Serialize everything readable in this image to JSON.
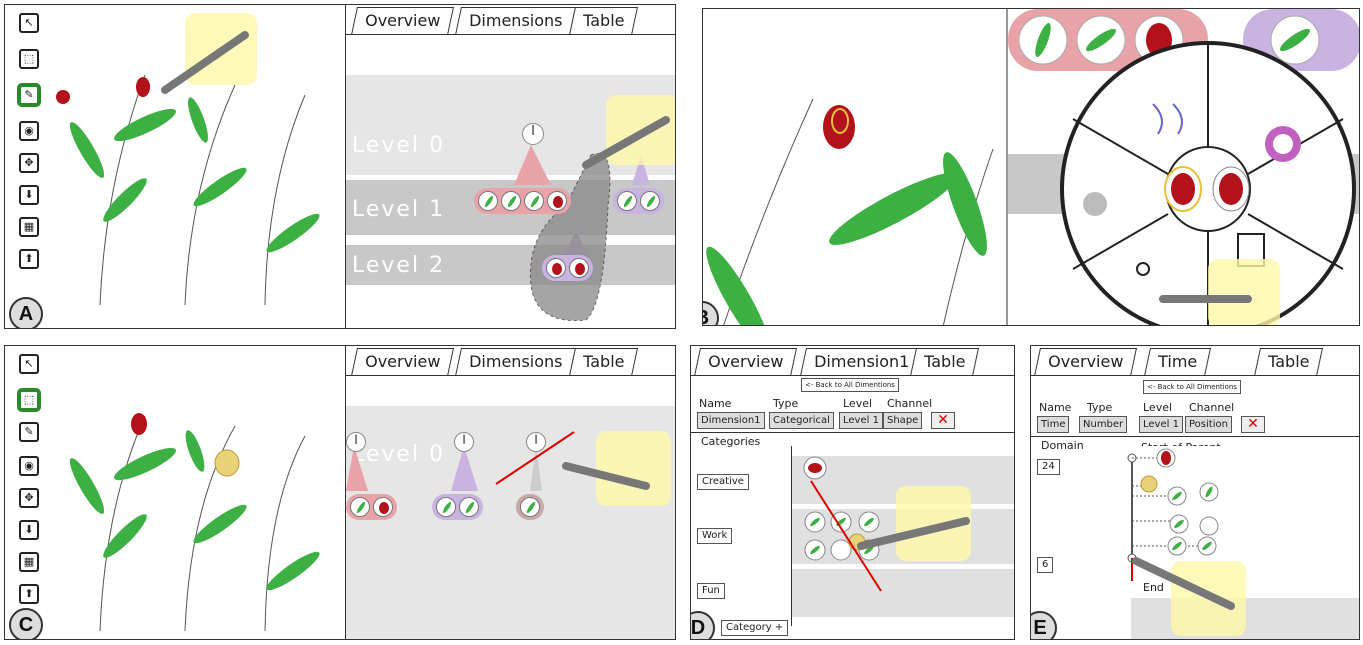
{
  "badges": {
    "a": "A",
    "b": "B",
    "c": "C",
    "d": "D",
    "e": "E"
  },
  "tabs": {
    "overview": "Overview",
    "dimensions": "Dimensions",
    "table": "Table",
    "dimension1": "Dimension1",
    "time": "Time"
  },
  "levels": {
    "l0": "Level 0",
    "l1": "Level 1",
    "l2": "Level 2"
  },
  "level_marker": "l",
  "panel_d": {
    "back_link": "<- Back to All Dimentions",
    "headers": {
      "name": "Name",
      "type": "Type",
      "level": "Level",
      "channel": "Channel"
    },
    "values": {
      "name": "Dimension1",
      "type": "Categorical",
      "level": "Level 1",
      "channel": "Shape"
    },
    "delete": "✕",
    "categories_label": "Categories",
    "categories": [
      "Creative",
      "Work",
      "Fun"
    ],
    "add_category": "Category +"
  },
  "panel_e": {
    "back_link": "<- Back to All Dimentions",
    "headers": {
      "name": "Name",
      "type": "Type",
      "level": "Level",
      "channel": "Channel"
    },
    "values": {
      "name": "Time",
      "type": "Number",
      "level": "Level 1",
      "channel": "Position"
    },
    "delete": "✕",
    "domain_label": "Domain",
    "start_label": "Start of Parent",
    "end_label": "End",
    "domain_max": "24",
    "domain_min": "6"
  },
  "colors": {
    "pink": "#e8a3a8",
    "lavender": "#c9b3e0",
    "leaf": "#3cb043",
    "flower": "#b3121a",
    "band_light": "#e6e6e6",
    "band_dark": "#c8c8c8",
    "active_tool": "#2a8a2a"
  },
  "toolbar_icons": [
    "select-icon",
    "lasso-icon",
    "brush-icon",
    "eye-icon",
    "move-icon",
    "download-icon",
    "stamp-icon",
    "upload-icon"
  ]
}
